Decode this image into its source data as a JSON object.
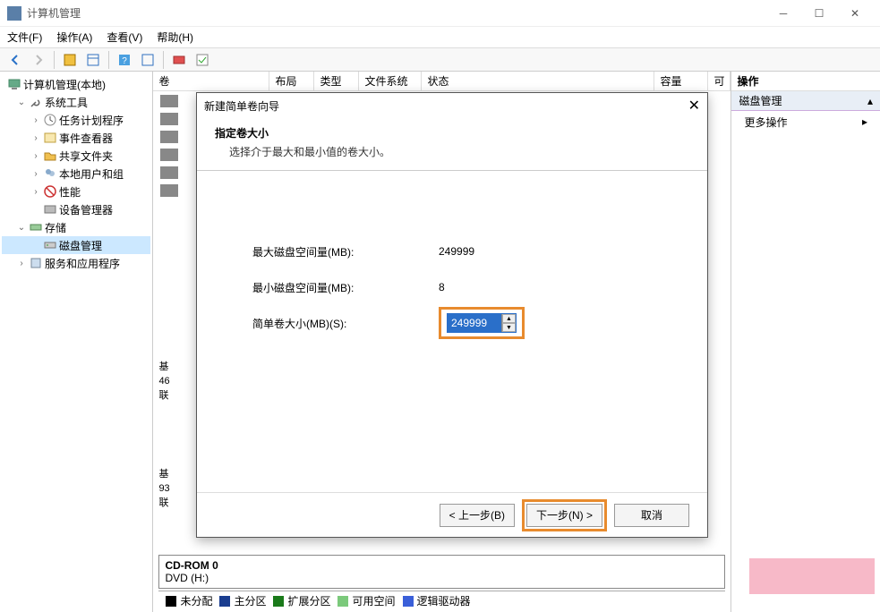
{
  "window": {
    "title": "计算机管理"
  },
  "menu": {
    "file": "文件(F)",
    "action": "操作(A)",
    "view": "查看(V)",
    "help": "帮助(H)"
  },
  "tree": {
    "root": "计算机管理(本地)",
    "system_tools": "系统工具",
    "task_scheduler": "任务计划程序",
    "event_viewer": "事件查看器",
    "shared_folders": "共享文件夹",
    "local_users": "本地用户和组",
    "performance": "性能",
    "device_manager": "设备管理器",
    "storage": "存储",
    "disk_management": "磁盘管理",
    "services_apps": "服务和应用程序"
  },
  "columns": {
    "volume": "卷",
    "layout": "布局",
    "type": "类型",
    "fs": "文件系统",
    "status": "状态",
    "capacity": "容量",
    "free": "可"
  },
  "rightpane": {
    "header": "操作",
    "category": "磁盘管理",
    "more": "更多操作"
  },
  "disks": {
    "partial1": {
      "l1": "基",
      "l2": "46",
      "l3": "联"
    },
    "partial2": {
      "l1": "基",
      "l2": "93",
      "l3": "联"
    },
    "cd": {
      "title": "CD-ROM 0",
      "sub": "DVD (H:)"
    }
  },
  "legend": {
    "unalloc": "未分配",
    "primary": "主分区",
    "extended": "扩展分区",
    "free": "可用空间",
    "logical": "逻辑驱动器"
  },
  "wizard": {
    "title": "新建简单卷向导",
    "head": "指定卷大小",
    "sub": "选择介于最大和最小值的卷大小。",
    "max_label": "最大磁盘空间量(MB):",
    "max_value": "249999",
    "min_label": "最小磁盘空间量(MB):",
    "min_value": "8",
    "size_label": "简单卷大小(MB)(S):",
    "size_value": "249999",
    "back": "< 上一步(B)",
    "next": "下一步(N) >",
    "cancel": "取消"
  }
}
